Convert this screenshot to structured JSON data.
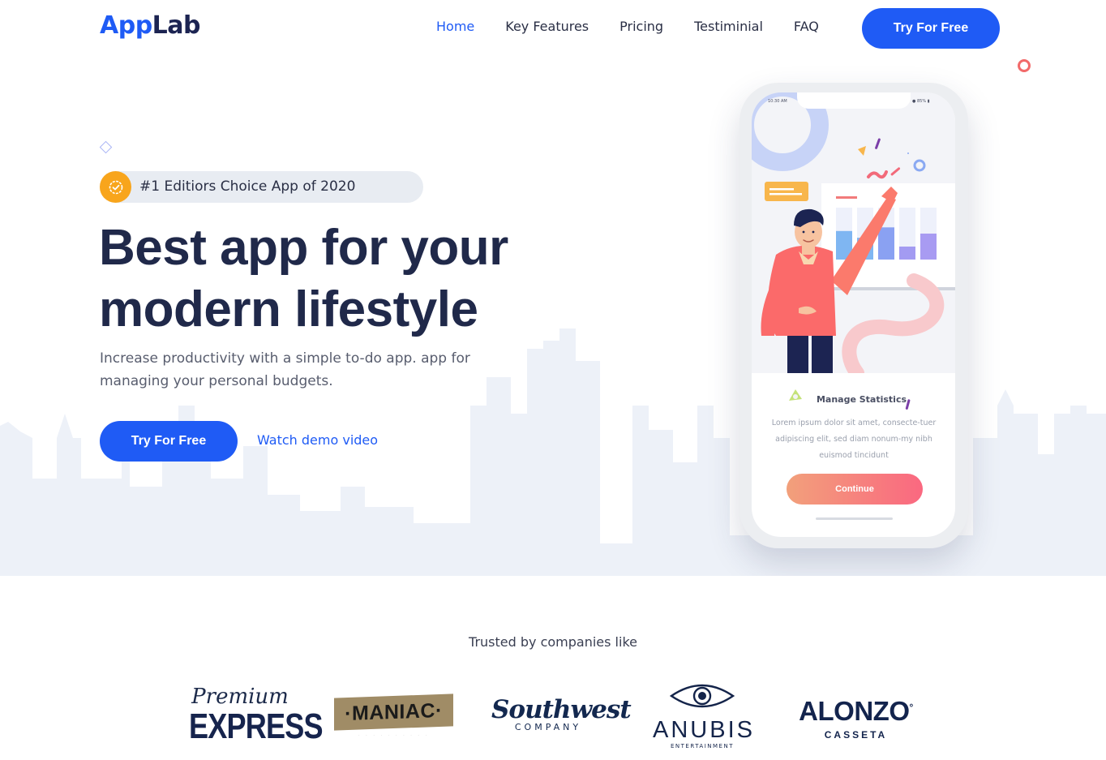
{
  "brand": {
    "logo_part1": "App",
    "logo_part2": "Lab"
  },
  "nav": {
    "items": [
      {
        "label": "Home",
        "active": true
      },
      {
        "label": "Key Features",
        "active": false
      },
      {
        "label": "Pricing",
        "active": false
      },
      {
        "label": "Testiminial",
        "active": false
      },
      {
        "label": "FAQ",
        "active": false
      }
    ],
    "cta_label": "Try For Free"
  },
  "hero": {
    "badge_text": "#1 Editiors Choice App of 2020",
    "headline_line1": "Best app for your",
    "headline_line2": "modern lifestyle",
    "subtitle": "Increase productivity with a simple to-do app. app for managing your personal budgets.",
    "cta_label": "Try For Free",
    "demo_link": "Watch demo video"
  },
  "phone": {
    "status_time": "10:30 AM",
    "status_battery": "85%",
    "card_title": "Manage Statistics",
    "card_body": "Lorem ipsum dolor sit amet, consecte-tuer adipiscing elit, sed diam nonum-my nibh euismod tincidunt",
    "continue_label": "Continue",
    "chart_bars": [
      0.55,
      0.42,
      0.62,
      0.25,
      0.5
    ]
  },
  "trusted": {
    "heading": "Trusted by companies like",
    "logos": {
      "premium_script": "Premium",
      "premium_block": "EXPRESS",
      "maniac": "MANIAC",
      "southwest_script": "Southwest",
      "southwest_sub": "COMPANY",
      "anubis": "ANUBIS",
      "anubis_sub": "ENTERTAINMENT",
      "alonzo": "ALONZO",
      "alonzo_sub": "CASSETA"
    }
  },
  "colors": {
    "primary": "#1f5bf5",
    "dark": "#20294a",
    "badge_orange": "#f8a51c",
    "skyline": "#edf1f8",
    "continue_gradient_start": "#f2a07b",
    "continue_gradient_end": "#fa6880"
  }
}
